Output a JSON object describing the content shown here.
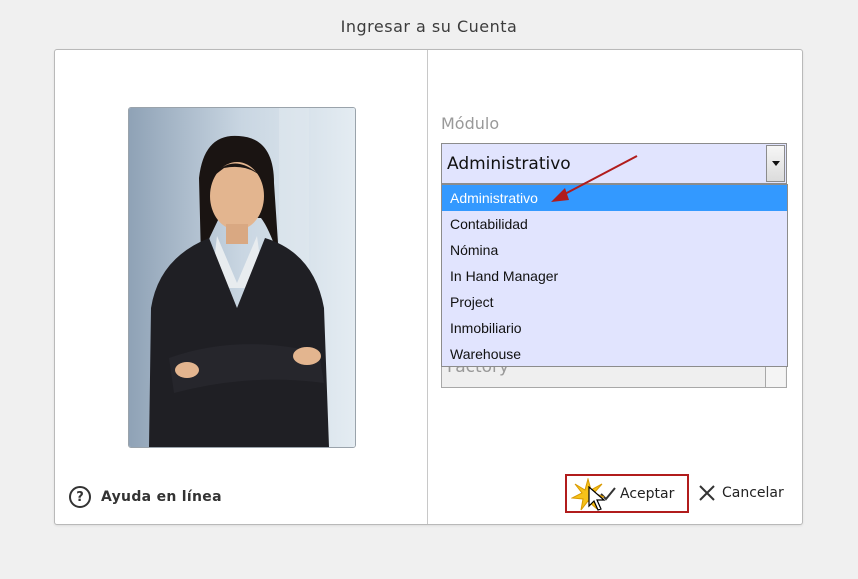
{
  "window": {
    "title": "Ingresar a su Cuenta"
  },
  "left_panel": {
    "photo_icon": "person-photo",
    "help_label": "Ayuda en línea",
    "help_icon": "question-circle-icon"
  },
  "form": {
    "module_label": "Módulo",
    "module_select": {
      "selected_value": "Administrativo",
      "options": [
        "Administrativo",
        "Contabilidad",
        "Nómina",
        "In Hand Manager",
        "Project",
        "Inmobiliario",
        "Warehouse"
      ],
      "highlighted_index": 0
    },
    "second_select_value": "Factory"
  },
  "buttons": {
    "accept_label": "Aceptar",
    "cancel_label": "Cancelar"
  },
  "colors": {
    "select_bg": "#e1e4fe",
    "highlight": "#3399ff",
    "annotation_red": "#b11c1c"
  }
}
